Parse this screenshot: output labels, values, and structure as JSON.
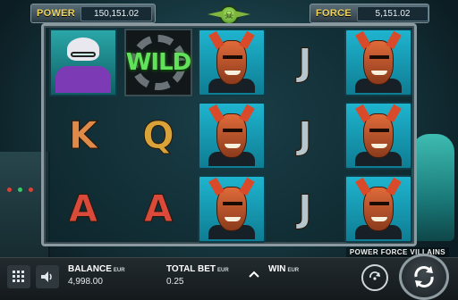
{
  "header": {
    "power_label": "POWER",
    "power_value": "150,151.02",
    "force_label": "FORCE",
    "force_value": "5,151.02"
  },
  "reels": [
    [
      "granny",
      "k",
      "a"
    ],
    [
      "wild",
      "q",
      "a"
    ],
    [
      "villain",
      "villain",
      "villain"
    ],
    [
      "j",
      "j",
      "j"
    ],
    [
      "villain",
      "villain",
      "villain"
    ]
  ],
  "symbols": {
    "wild_text": "WILD",
    "k": "K",
    "q": "Q",
    "a": "A",
    "j": "J"
  },
  "game_title": "POWER FORCE VILLAINS",
  "footer": {
    "balance_label": "BALANCE",
    "balance_currency": "EUR",
    "balance_value": "4,998.00",
    "bet_label": "TOTAL BET",
    "bet_currency": "EUR",
    "bet_value": "0.25",
    "win_label": "WIN",
    "win_currency": "EUR"
  },
  "icons": {
    "menu": "grid-icon",
    "sound": "speaker-icon",
    "bet_up": "chevron-up-icon",
    "autoplay": "autoplay-icon",
    "spin": "spin-icon"
  }
}
